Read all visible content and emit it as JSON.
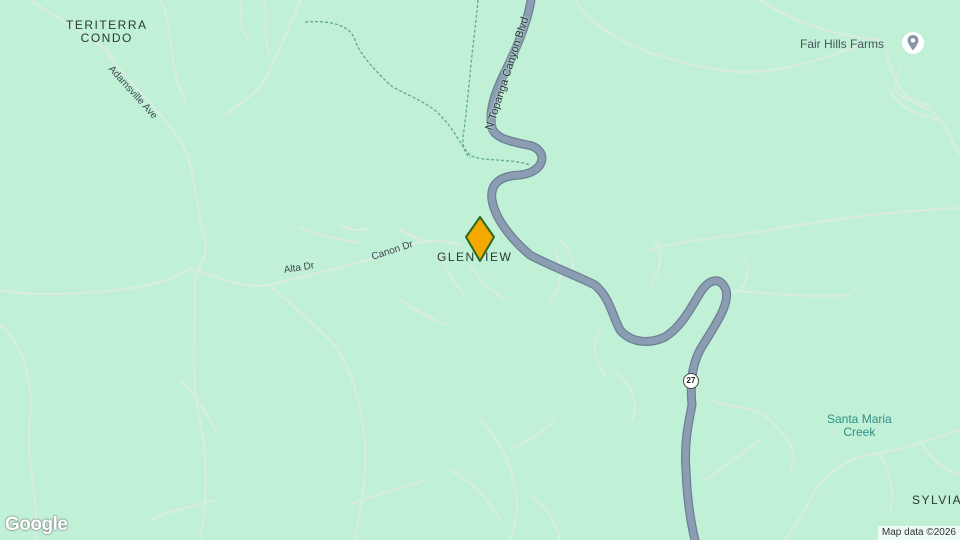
{
  "map": {
    "places": {
      "teriterra_line1": "TERITERRA",
      "teriterra_line2": "CONDO",
      "glenview": "GLENVIEW",
      "sylvia": "SYLVIA"
    },
    "poi": {
      "fair_hills_farms": "Fair Hills Farms"
    },
    "water": {
      "line1": "Santa Maria",
      "line2": "Creek"
    },
    "roads": {
      "topanga": "N Topanga Canyon Blvd",
      "adamsville": "Adamsville Ave",
      "canon": "Canon Dr",
      "alta": "Alta Dr"
    },
    "route_shield": "27",
    "branding": {
      "logo": "Google",
      "attribution": "Map data ©2026"
    },
    "colors": {
      "land": "#c0f0d6",
      "highway": "#8a9db3",
      "marker_fill": "#f5a800",
      "marker_stroke": "#2d6a1f",
      "poi_pin": "#8a96a3"
    },
    "icons": {
      "poi_pin": "place-pin-icon",
      "marker": "location-marker-icon"
    }
  }
}
